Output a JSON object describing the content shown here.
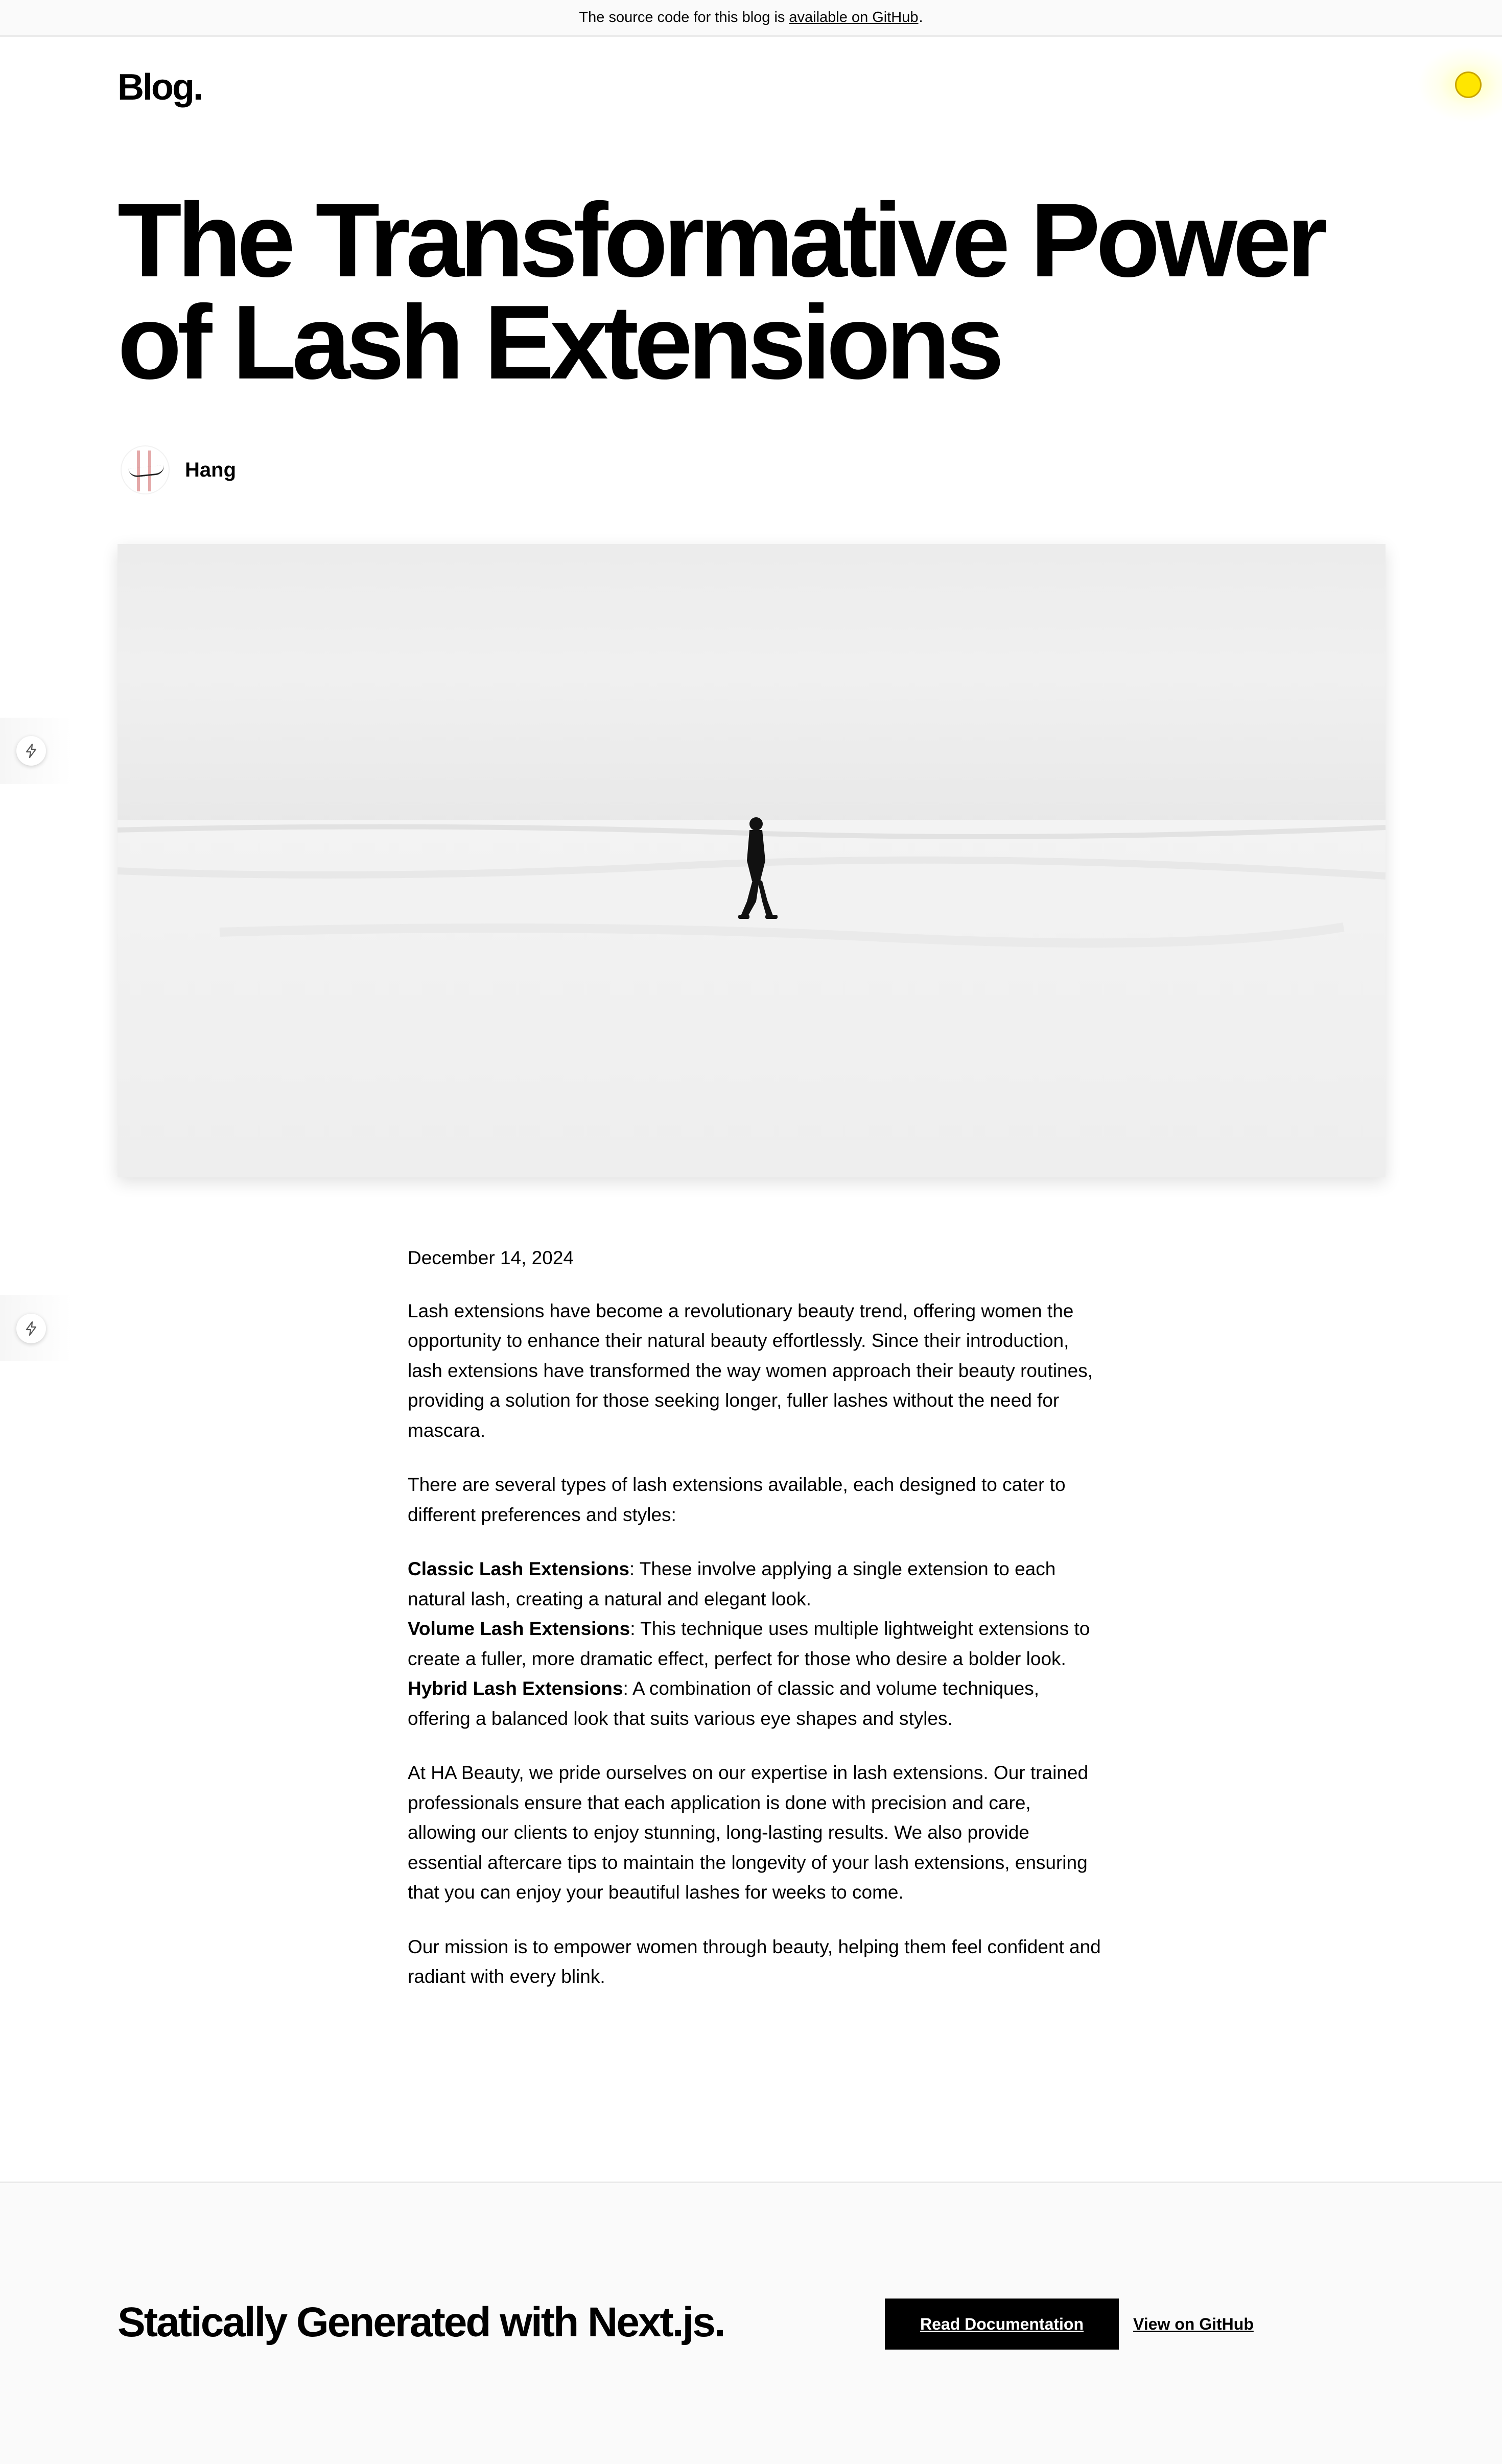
{
  "banner": {
    "text": "The source code for this blog is",
    "link": "available on GitHub",
    "period": "."
  },
  "logo": "Blog.",
  "post": {
    "title_line1": "The Transformative Power",
    "title_line2": "of Lash Extensions",
    "author": "Hang",
    "date": "December 14, 2024",
    "paragraphs": [
      "Lash extensions have become a revolutionary beauty trend, offering women the opportunity to enhance their natural beauty effortlessly. Since their introduction, lash extensions have transformed the way women approach their beauty routines, providing a solution for those seeking longer, fuller lashes without the need for mascara.",
      "There are several types of lash extensions available, each designed to cater to different preferences and styles:",
      "At HA Beauty, we pride ourselves on our expertise in lash extensions. Our trained professionals ensure that each application is done with precision and care, allowing our clients to enjoy stunning, long-lasting results. We also provide essential aftercare tips to maintain the longevity of your lash extensions, ensuring that you can enjoy your beautiful lashes for weeks to come.",
      "Our mission is to empower women through beauty, helping them feel confident and radiant with every blink."
    ],
    "types": [
      {
        "name": "Classic Lash Extensions",
        "desc": ": These involve applying a single extension to each natural lash, creating a natural and elegant look."
      },
      {
        "name": "Volume Lash Extensions",
        "desc": ": This technique uses multiple lightweight extensions to create a fuller, more dramatic effect, perfect for those who desire a bolder look."
      },
      {
        "name": "Hybrid Lash Extensions",
        "desc": ": A combination of classic and volume techniques, offering a balanced look that suits various eye shapes and styles."
      }
    ]
  },
  "footer": {
    "title": "Statically Generated with Next.js.",
    "read_docs": "Read Documentation",
    "view_github": "View on GitHub"
  },
  "icons": {
    "side_button": "bolt-icon",
    "indicator": "yellow-dot"
  },
  "colors": {
    "indicator": "#ffe600",
    "banner_bg": "#fafafa",
    "footer_bg": "#fafafa",
    "button_bg": "#000000"
  }
}
